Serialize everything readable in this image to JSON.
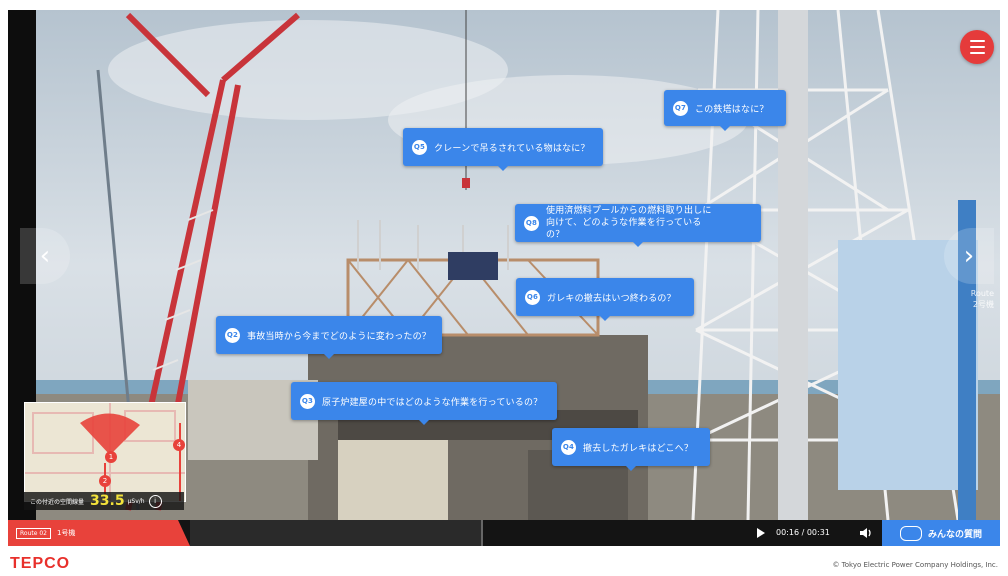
{
  "menu": {
    "icon": "hamburger-menu-icon"
  },
  "questions": [
    {
      "num": "Q7",
      "text": "この鉄塔はなに？"
    },
    {
      "num": "Q5",
      "text": "クレーンで吊るされている物はなに？"
    },
    {
      "num": "Q8",
      "text": "使用済燃料プールからの燃料取り出しに向けて、どのような作業を行っているの？"
    },
    {
      "num": "Q6",
      "text": "ガレキの撤去はいつ終わるの？"
    },
    {
      "num": "Q2",
      "text": "事故当時から今までどのように変わったの？"
    },
    {
      "num": "Q3",
      "text": "原子炉建屋の中ではどのような作業を行っているの？"
    },
    {
      "num": "Q4",
      "text": "撤去したガレキはどこへ？"
    }
  ],
  "nav": {
    "prev_icon": "chevron-left-icon",
    "next_icon": "chevron-right-icon",
    "next_route_line1": "Route",
    "next_route_line2": "2号機"
  },
  "minimap": {
    "marker_a": "1",
    "marker_b": "2",
    "marker_c": "4"
  },
  "dose": {
    "label": "この付近の空間線量",
    "value": "33.5",
    "unit": "μSv/h",
    "info": "i"
  },
  "player": {
    "route_badge": "Route 02",
    "route_name": "1号機",
    "time": "00:16 / 00:31",
    "played_fraction": 0.52,
    "everyone_label": "みんなの質問"
  },
  "footer": {
    "logo": "TEPCO",
    "copyright": "© Tokyo Electric Power Company Holdings, Inc."
  },
  "colors": {
    "accent_blue": "#3b86ea",
    "brand_red": "#e8302b",
    "menu_red": "#e53b3b"
  }
}
